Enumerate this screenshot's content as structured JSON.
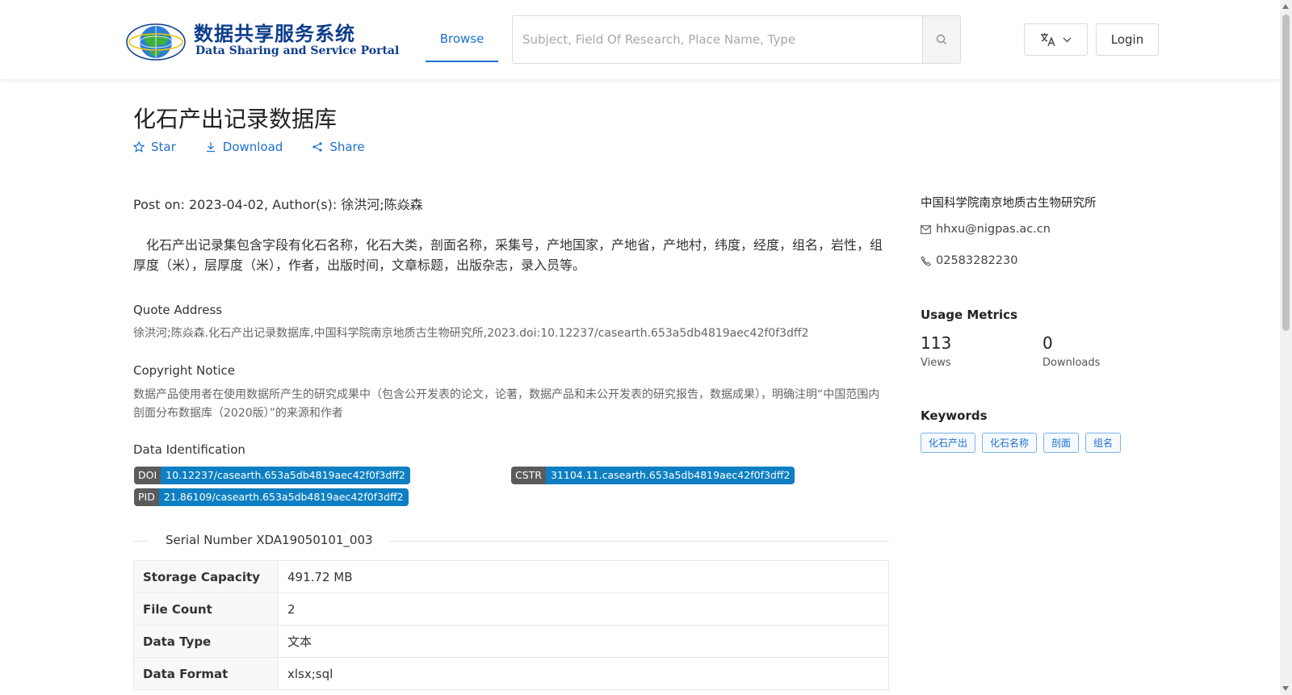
{
  "header": {
    "logo_cn": "数据共享服务系统",
    "logo_en": "Data Sharing and Service Portal",
    "nav_browse": "Browse",
    "search_placeholder": "Subject, Field Of Research, Place Name, Type",
    "login_label": "Login"
  },
  "dataset": {
    "title": "化石产出记录数据库",
    "actions": {
      "star": "Star",
      "download": "Download",
      "share": "Share"
    },
    "post_on": "Post on: 2023-04-02, Author(s): 徐洪河;陈焱森",
    "description": "化石产出记录集包含字段有化石名称，化石大类，剖面名称，采集号，产地国家，产地省，产地村，纬度，经度，组名，岩性，组厚度（米），层厚度（米），作者，出版时间，文章标题，出版杂志，录入员等。",
    "quote_heading": "Quote Address",
    "quote_text": "徐洪河;陈焱森.化石产出记录数据库,中国科学院南京地质古生物研究所,2023.doi:10.12237/casearth.653a5db4819aec42f0f3dff2",
    "copyright_heading": "Copyright Notice",
    "copyright_text": "数据产品使用者在使用数据所产生的研究成果中（包含公开发表的论文，论著，数据产品和未公开发表的研究报告，数据成果），明确注明“中国范围内剖面分布数据库（2020版）”的来源和作者",
    "identification_heading": "Data Identification",
    "identifiers": {
      "doi": {
        "label": "DOI",
        "value": "10.12237/casearth.653a5db4819aec42f0f3dff2"
      },
      "cstr": {
        "label": "CSTR",
        "value": "31104.11.casearth.653a5db4819aec42f0f3dff2"
      },
      "pid": {
        "label": "PID",
        "value": "21.86109/casearth.653a5db4819aec42f0f3dff2"
      }
    },
    "serial_number": "Serial Number XDA19050101_003",
    "info_rows": [
      {
        "key": "Storage Capacity",
        "value": "491.72 MB"
      },
      {
        "key": "File Count",
        "value": "2"
      },
      {
        "key": "Data Type",
        "value": "文本"
      },
      {
        "key": "Data Format",
        "value": "xlsx;sql"
      }
    ]
  },
  "sidebar": {
    "organization": "中国科学院南京地质古生物研究所",
    "email": "hhxu@nigpas.ac.cn",
    "phone": "02583282230",
    "usage_heading": "Usage Metrics",
    "views_count": "113",
    "views_label": "Views",
    "downloads_count": "0",
    "downloads_label": "Downloads",
    "keywords_heading": "Keywords",
    "keywords": [
      "化石产出",
      "化石名称",
      "剖面",
      "组名"
    ]
  },
  "colors": {
    "accent": "#1e6fcf",
    "badge_value": "#0d7fc2",
    "badge_label": "#5b5b5b",
    "logo_blue": "#0e3d8c"
  }
}
